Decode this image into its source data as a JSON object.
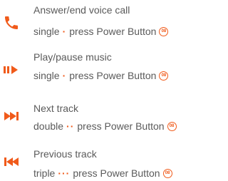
{
  "accent_color": "#f05a1a",
  "text_color": "#5a5a5a",
  "items": [
    {
      "icon": "phone-icon",
      "title": "Answer/end voice call",
      "press_count": "single",
      "dots": "·",
      "action": "press Power Button",
      "badge": "08"
    },
    {
      "icon": "play-pause-icon",
      "title": "Play/pause music",
      "press_count": "single",
      "dots": "·",
      "action": "press Power Button",
      "badge": "08"
    },
    {
      "icon": "next-track-icon",
      "title": "Next track",
      "press_count": "double",
      "dots": "··",
      "action": "press Power Button",
      "badge": "08"
    },
    {
      "icon": "previous-track-icon",
      "title": "Previous track",
      "press_count": "triple",
      "dots": "···",
      "action": "press Power Button",
      "badge": "08"
    }
  ]
}
